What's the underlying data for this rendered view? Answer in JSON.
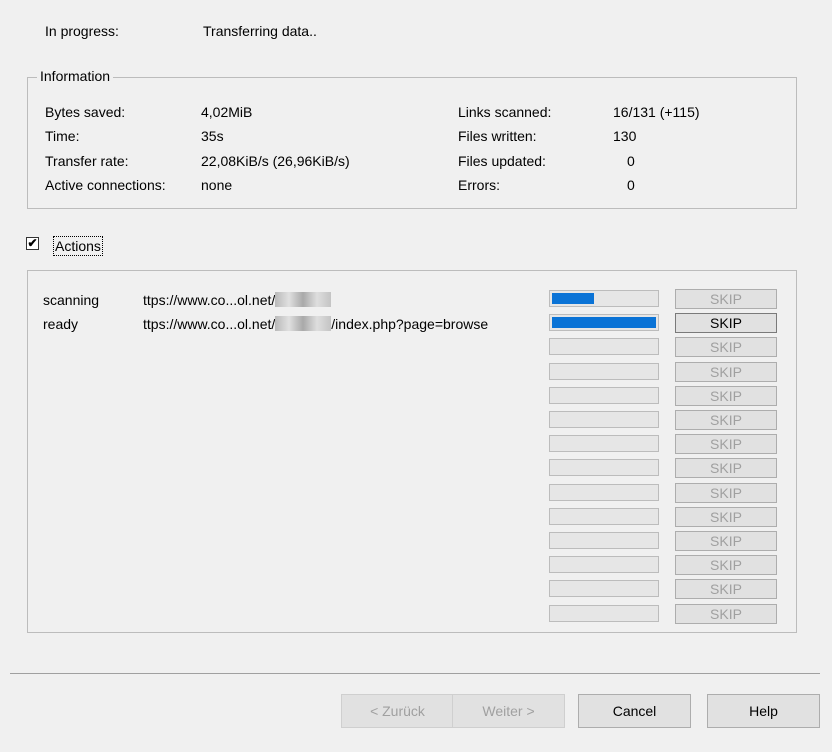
{
  "status": {
    "label": "In progress:",
    "value": "Transferring data.."
  },
  "information": {
    "legend": "Information",
    "left": [
      {
        "label": "Bytes saved:",
        "value": "4,02MiB"
      },
      {
        "label": "Time:",
        "value": "35s"
      },
      {
        "label": "Transfer rate:",
        "value": "22,08KiB/s (26,96KiB/s)"
      },
      {
        "label": "Active connections:",
        "value": "none"
      }
    ],
    "right": [
      {
        "label": "Links scanned:",
        "value": "16/131 (+115)"
      },
      {
        "label": "Files written:",
        "value": "130"
      },
      {
        "label": "Files updated:",
        "value": "0"
      },
      {
        "label": "Errors:",
        "value": "0"
      }
    ]
  },
  "actions": {
    "label": "Actions",
    "checked": true,
    "tasks": [
      {
        "status": "scanning",
        "url_prefix": "ttps://www.co...ol.net/",
        "url_suffix": "",
        "progress": 0.4,
        "skip_enabled": false
      },
      {
        "status": "ready",
        "url_prefix": "ttps://www.co...ol.net/",
        "url_suffix": "/index.php?page=browse",
        "progress": 1.0,
        "skip_enabled": true
      }
    ],
    "skip_label": "SKIP",
    "total_slots": 14
  },
  "buttons": {
    "back": "< Zurück",
    "next": "Weiter >",
    "cancel": "Cancel",
    "help": "Help"
  }
}
